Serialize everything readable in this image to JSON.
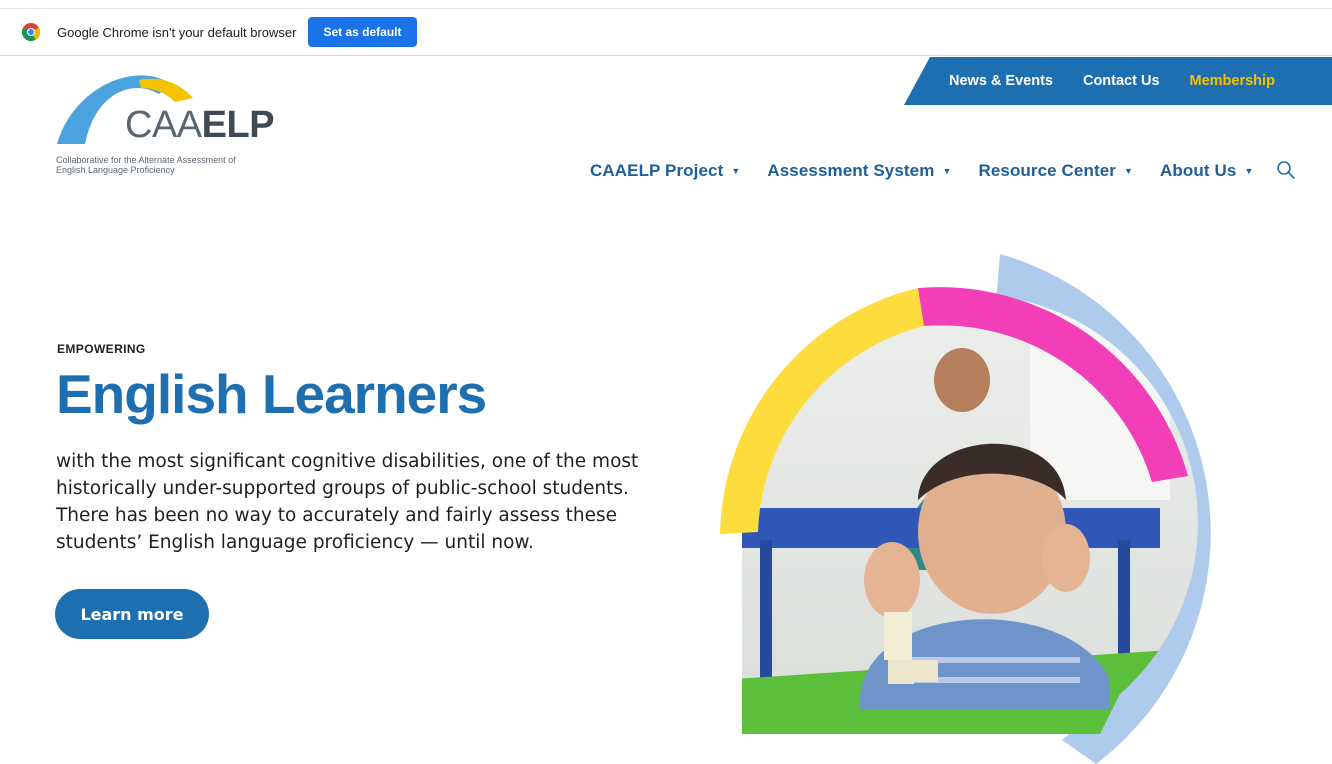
{
  "infobar": {
    "message": "Google Chrome isn't your default browser",
    "button_label": "Set as default"
  },
  "utility_nav": {
    "items": [
      "News & Events",
      "Contact Us",
      "Membership"
    ]
  },
  "logo": {
    "word_light": "CAA",
    "word_bold": "ELP",
    "tagline_line1": "Collaborative for the Alternate Assessment of",
    "tagline_line2": "English Language Proficiency"
  },
  "main_nav": {
    "items": [
      {
        "label": "CAAELP Project"
      },
      {
        "label": "Assessment System"
      },
      {
        "label": "Resource Center"
      },
      {
        "label": "About Us"
      }
    ],
    "caret": "▼"
  },
  "hero": {
    "eyebrow": "EMPOWERING",
    "title": "English Learners",
    "body": "with the most significant cognitive disabilities, one of the most historically under-supported groups of public-school students. There has been no way to accurately and fairly assess these students’ English language proficiency — until now.",
    "button_label": "Learn more"
  },
  "colors": {
    "brand_blue": "#1e6fb0",
    "accent_yellow": "#f5c200",
    "arc_yellow": "#fddc3e",
    "arc_pink": "#f23fb8",
    "arc_light_blue": "#aecbee"
  },
  "icons": {
    "browser": "chrome-icon",
    "search": "search-icon",
    "nav_caret": "caret-down-icon"
  }
}
